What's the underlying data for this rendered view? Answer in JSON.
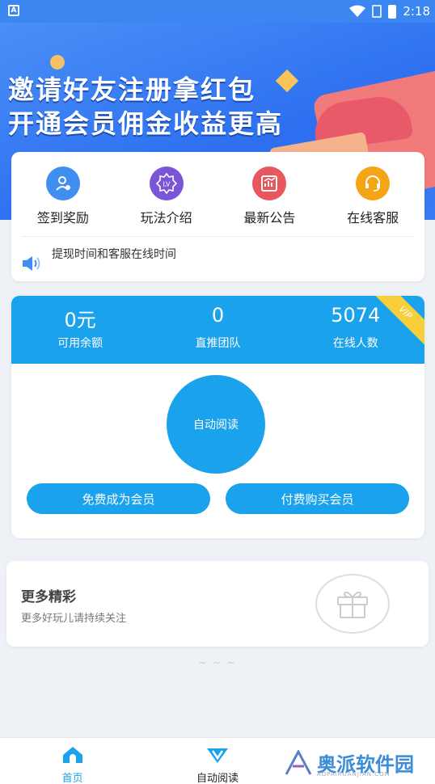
{
  "status_bar": {
    "time": "2:18",
    "a_badge": "A"
  },
  "banner": {
    "line1": "邀请好友注册拿红包",
    "line2": "开通会员佣金收益更高"
  },
  "menu": {
    "items": [
      {
        "label": "签到奖励",
        "icon": "user-check-icon",
        "color": "#3f8ef0"
      },
      {
        "label": "玩法介绍",
        "icon": "lv-badge-icon",
        "color": "#7a55d8",
        "icon_text": "LV"
      },
      {
        "label": "最新公告",
        "icon": "chart-icon",
        "color": "#e8575d"
      },
      {
        "label": "在线客服",
        "icon": "headset-icon",
        "color": "#f3a514"
      }
    ],
    "notice": "提现时间和客服在线时间"
  },
  "stats": {
    "items": [
      {
        "value": "0元",
        "caption": "可用余额"
      },
      {
        "value": "0",
        "caption": "直推团队"
      },
      {
        "value": "5074",
        "caption": "在线人数"
      }
    ],
    "vip_label": "VIP",
    "auto_read": "自动阅读",
    "free_member": "免费成为会员",
    "buy_member": "付费购买会员",
    "accent": "#1aa2ec"
  },
  "more": {
    "title": "更多精彩",
    "subtitle": "更多好玩儿请持续关注"
  },
  "tilde": "~ ~ ~",
  "nav": {
    "items": [
      {
        "label": "首页",
        "icon": "home-icon"
      },
      {
        "label": "自动阅读",
        "icon": "v-diamond-icon"
      }
    ]
  },
  "watermark": {
    "text": "奥派软件园",
    "sub": "AOPAIRUANJIAN.COM"
  }
}
